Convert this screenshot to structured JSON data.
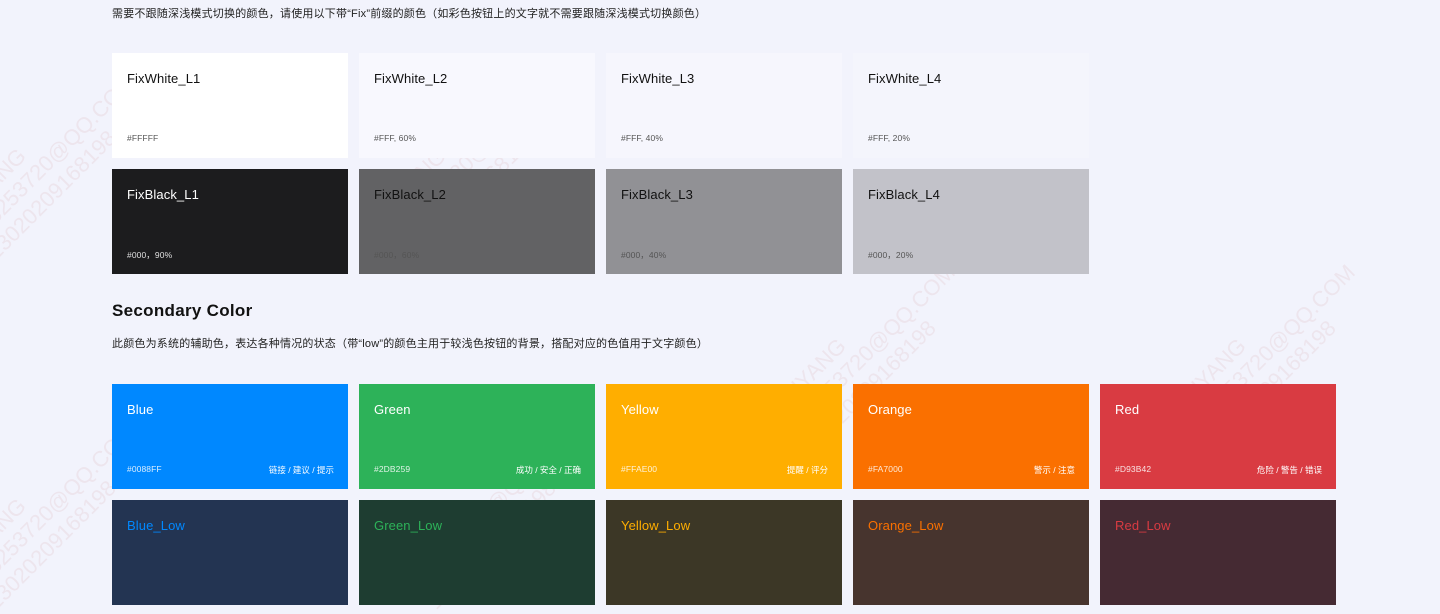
{
  "fix_section": {
    "description": "需要不跟随深浅模式切换的颜色，请使用以下带“Fix”前缀的颜色（如彩色按钮上的文字就不需要跟随深浅模式切换颜色）",
    "white_swatches": [
      {
        "name": "FixWhite_L1",
        "code": "#FFFFF",
        "color": "#FFFFFF"
      },
      {
        "name": "FixWhite_L2",
        "code": "#FFF, 60%",
        "color": "#F8F8FE"
      },
      {
        "name": "FixWhite_L3",
        "code": "#FFF, 40%",
        "color": "#F6F6FD"
      },
      {
        "name": "FixWhite_L4",
        "code": "#FFF, 20%",
        "color": "#F4F5FC"
      }
    ],
    "black_swatches": [
      {
        "name": "FixBlack_L1",
        "code": "#000，90%",
        "color": "#1C1C1E"
      },
      {
        "name": "FixBlack_L2",
        "code": "#000，60%",
        "color": "#626264"
      },
      {
        "name": "FixBlack_L3",
        "code": "#000，40%",
        "color": "#919195"
      },
      {
        "name": "FixBlack_L4",
        "code": "#000，20%",
        "color": "#C2C2C9"
      }
    ]
  },
  "secondary_section": {
    "title": "Secondary Color",
    "description": "此颜色为系统的辅助色，表达各种情况的状态（带“low”的颜色主用于较浅色按钮的背景，搭配对应的色值用于文字颜色）",
    "swatches": [
      {
        "name": "Blue",
        "code": "#0088FF",
        "usage": "链接 / 建议 / 提示",
        "color": "#0088FF"
      },
      {
        "name": "Green",
        "code": "#2DB259",
        "usage": "成功 / 安全 / 正确",
        "color": "#2DB259"
      },
      {
        "name": "Yellow",
        "code": "#FFAE00",
        "usage": "提醒 / 评分",
        "color": "#FFAE00"
      },
      {
        "name": "Orange",
        "code": "#FA7000",
        "usage": "警示 / 注意",
        "color": "#FA7000"
      },
      {
        "name": "Red",
        "code": "#D93B42",
        "usage": "危险 / 警告 / 错误",
        "color": "#D93B42"
      }
    ],
    "low_swatches": [
      {
        "name": "Blue_Low",
        "color": "#233452",
        "text_color": "#0088FF"
      },
      {
        "name": "Green_Low",
        "color": "#1E3D31",
        "text_color": "#2DB259"
      },
      {
        "name": "Yellow_Low",
        "color": "#3C3726",
        "text_color": "#FFAE00"
      },
      {
        "name": "Orange_Low",
        "color": "#47342E",
        "text_color": "#FA7000"
      },
      {
        "name": "Red_Low",
        "color": "#452A33",
        "text_color": "#D93B42"
      }
    ]
  },
  "watermark": {
    "lines": [
      "LIUYANG",
      "395253720@QQ.COM",
      "13020209168198"
    ]
  }
}
